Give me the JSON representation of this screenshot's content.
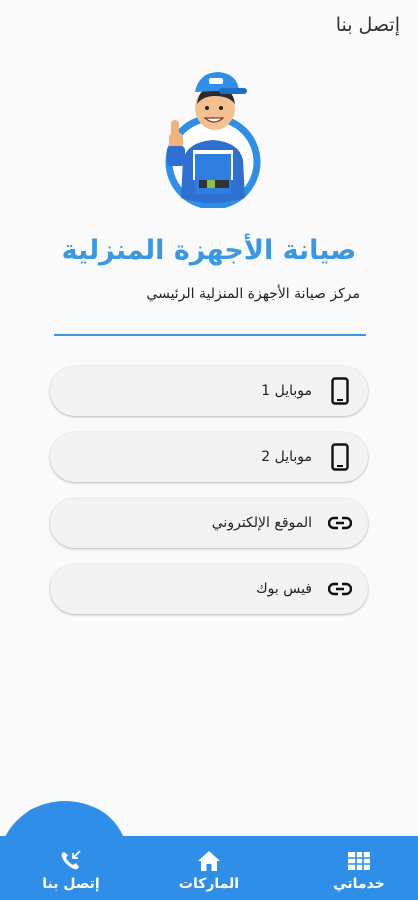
{
  "header": {
    "title": "إتصل بنا"
  },
  "brand": {
    "name": "صيانة الأجهزة المنزلية",
    "subtitle": "مركز صيانة الأجهزة المنزلية الرئيسي",
    "accent_color": "#3a97e4"
  },
  "contacts": [
    {
      "label": "موبايل 1",
      "icon": "mobile-phone-icon"
    },
    {
      "label": "موبايل 2",
      "icon": "mobile-phone-icon"
    },
    {
      "label": "الموقع الإلكتروني",
      "icon": "link-icon"
    },
    {
      "label": "فيس بوك",
      "icon": "link-icon"
    }
  ],
  "bottom_nav": {
    "background": "#2f8fe8",
    "items": [
      {
        "label": "خدماتي",
        "icon": "grid-list-icon"
      },
      {
        "label": "الماركات",
        "icon": "home-icon"
      },
      {
        "label": "إتصل بنا",
        "icon": "phone-call-icon",
        "active": true
      }
    ]
  }
}
